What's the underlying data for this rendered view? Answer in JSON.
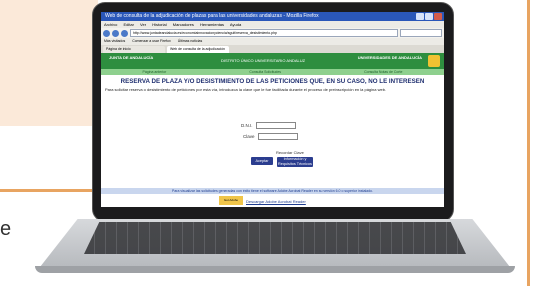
{
  "background": {
    "edge_text": "e",
    "accent_color": "#e8a461"
  },
  "browser": {
    "window_title": "Web de consulta de la adjudicación de plazas para las universidades andaluzas - Mozilla Firefox",
    "menu": [
      "Archivo",
      "Editar",
      "Ver",
      "Historial",
      "Marcadores",
      "Herramientas",
      "Ayuda"
    ],
    "address": "http://www.juntadeandalucia.es/economiainnovacionyciencia/sguit/reserva_desistimiento.php",
    "bookmarks": [
      "Más visitados",
      "Comenzar a usar Firefox",
      "Últimas noticias"
    ],
    "tabs": [
      "Página de inicio",
      "Web de consulta de la adjudicación"
    ]
  },
  "page": {
    "banner_left": "JUNTA DE ANDALUCÍA",
    "banner_center": "DISTRITO ÚNICO UNIVERSITARIO ANDALUZ",
    "banner_right": "UNIVERSIDADES DE ANDALUCÍA",
    "subnav": [
      "Página anterior",
      "Consulta Solicitudes",
      "Consulta Notas de Corte"
    ],
    "title": "RESERVA DE PLAZA Y/O DESISTIMIENTO DE LAS PETICIONES QUE, EN SU CASO, NO LE INTERESEN",
    "instructions": "Para solicitar reserva o desistimiento de peticiones por esta vía, introduzca la clave que le fue facilitada durante el proceso de preinscripción en la página web.",
    "dni_label": "D.N.I.",
    "clave_label": "Clave",
    "link_olvido": "Recordar Clave",
    "btn_aceptar": "Aceptar",
    "btn_info": "Información y Requisitos Técnicos",
    "bottom_note": "Para visualizar las solicitudes generadas con éxito tiene el software Adobe Acrobat Reader en su versión 6.0 o superior instalado.",
    "adobe_badge": "Get Adobe Reader",
    "adobe_link": "Descargar Adobe Acrobat Reader"
  }
}
